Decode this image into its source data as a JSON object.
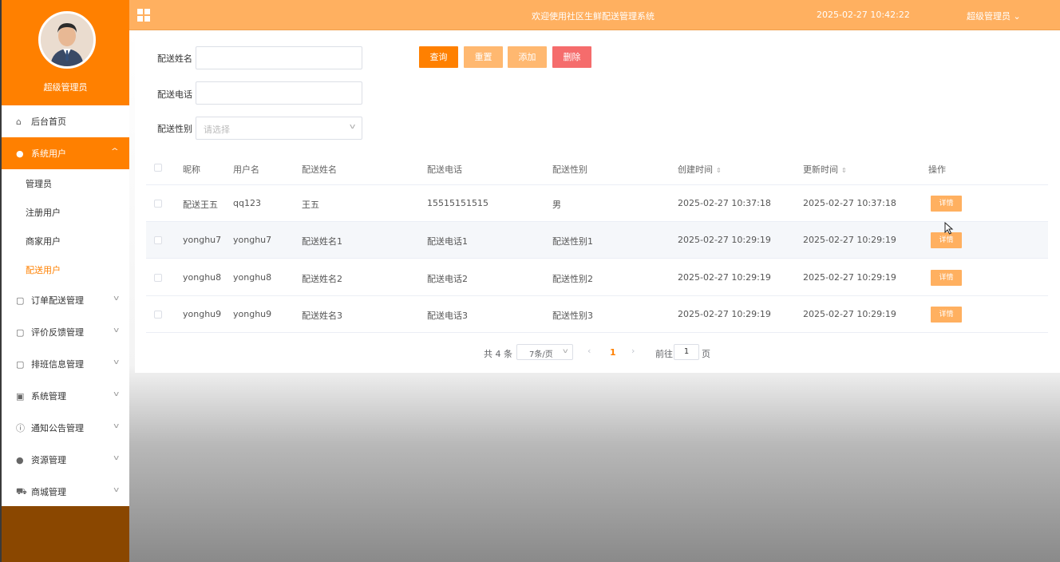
{
  "header": {
    "system_title": "欢迎使用社区生鲜配送管理系统",
    "datetime": "2025-02-27 10:42:22",
    "user_menu": "超级管理员 ⌄"
  },
  "sidebar": {
    "user_name": "超级管理员",
    "items": [
      {
        "label": "后台首页",
        "icon": "home-icon"
      },
      {
        "label": "系统用户",
        "icon": "user-icon",
        "expanded": true,
        "children": [
          "管理员",
          "注册用户",
          "商家用户",
          "配送用户"
        ],
        "selected_child": "配送用户"
      },
      {
        "label": "订单配送管理",
        "icon": "doc-icon"
      },
      {
        "label": "评价反馈管理",
        "icon": "doc-icon"
      },
      {
        "label": "排班信息管理",
        "icon": "doc-icon"
      },
      {
        "label": "系统管理",
        "icon": "image-icon"
      },
      {
        "label": "通知公告管理",
        "icon": "info-icon"
      },
      {
        "label": "资源管理",
        "icon": "location-icon"
      },
      {
        "label": "商城管理",
        "icon": "cart-icon"
      }
    ]
  },
  "filters": {
    "name_label": "配送姓名",
    "name_value": "",
    "phone_label": "配送电话",
    "phone_value": "",
    "gender_label": "配送性别",
    "gender_placeholder": "请选择"
  },
  "buttons": {
    "search": "查询",
    "reset": "重置",
    "add": "添加",
    "delete": "删除"
  },
  "table": {
    "columns": [
      "昵称",
      "用户名",
      "配送姓名",
      "配送电话",
      "配送性别",
      "创建时间",
      "更新时间",
      "操作"
    ],
    "detail_label": "详情",
    "rows": [
      {
        "nickname": "配送王五",
        "username": "qq123",
        "name": "王五",
        "phone": "15515151515",
        "gender": "男",
        "created": "2025-02-27 10:37:18",
        "updated": "2025-02-27 10:37:18"
      },
      {
        "nickname": "yonghu7",
        "username": "yonghu7",
        "name": "配送姓名1",
        "phone": "配送电话1",
        "gender": "配送性别1",
        "created": "2025-02-27 10:29:19",
        "updated": "2025-02-27 10:29:19"
      },
      {
        "nickname": "yonghu8",
        "username": "yonghu8",
        "name": "配送姓名2",
        "phone": "配送电话2",
        "gender": "配送性别2",
        "created": "2025-02-27 10:29:19",
        "updated": "2025-02-27 10:29:19"
      },
      {
        "nickname": "yonghu9",
        "username": "yonghu9",
        "name": "配送姓名3",
        "phone": "配送电话3",
        "gender": "配送性别3",
        "created": "2025-02-27 10:29:19",
        "updated": "2025-02-27 10:29:19"
      }
    ]
  },
  "pagination": {
    "total": "共 4 条",
    "page_size": "7条/页",
    "prev": "‹",
    "current": "1",
    "next": "›",
    "goto_label": "前往",
    "goto_value": "1",
    "page_suffix": "页"
  },
  "colors": {
    "accent": "#ff8000",
    "topbar": "#ffb060",
    "danger": "#f56c6c"
  }
}
